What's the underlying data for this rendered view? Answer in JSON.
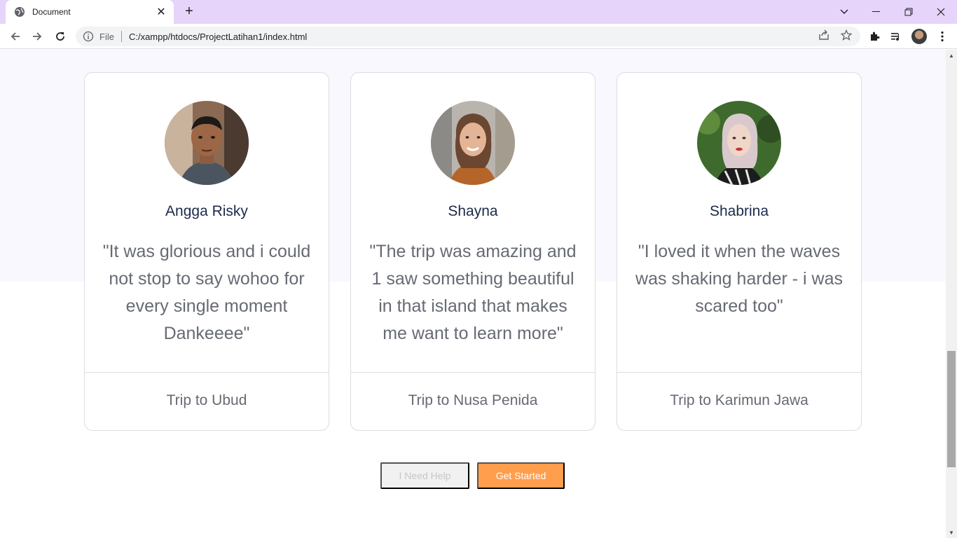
{
  "browser": {
    "tab_title": "Document",
    "address_scheme": "File",
    "address_url": "C:/xampp/htdocs/ProjectLatihan1/index.html"
  },
  "testimonials": [
    {
      "name": "Angga Risky",
      "quote": "\"It was glorious and i could not stop to say wohoo for every single moment Dankeeee\"",
      "trip": "Trip to Ubud"
    },
    {
      "name": "Shayna",
      "quote": "\"The trip was amazing and 1 saw something beautiful in that island that makes me want to learn more\"",
      "trip": "Trip to Nusa Penida"
    },
    {
      "name": "Shabrina",
      "quote": "\"I loved it when the waves was shaking harder - i was scared too\"",
      "trip": "Trip to Karimun Jawa"
    }
  ],
  "actions": {
    "help_label": "I Need Help",
    "start_label": "Get Started"
  },
  "colors": {
    "tabbar": "#e6d4fb",
    "section_band": "#f8f8fe",
    "primary_button": "#ff9e4d",
    "name_text": "#1c2a4a"
  }
}
